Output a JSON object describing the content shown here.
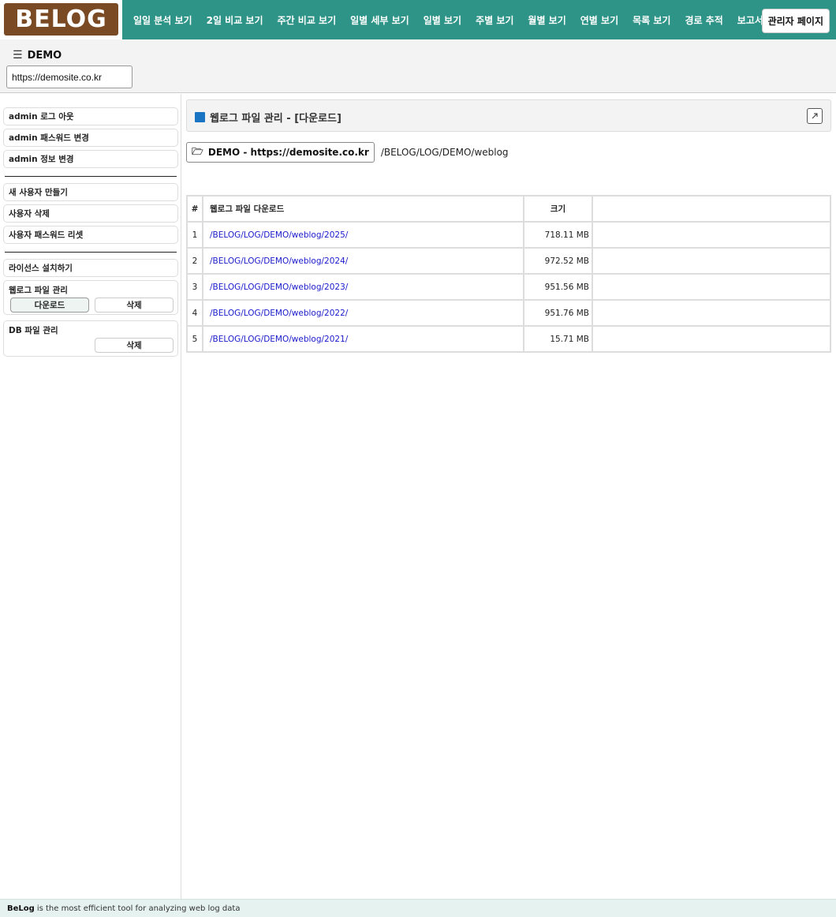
{
  "logo": {
    "text": "BELOG"
  },
  "nav": {
    "items": [
      "일일 분석 보기",
      "2일 비교 보기",
      "주간 비교 보기",
      "일별 세부 보기",
      "일별 보기",
      "주별 보기",
      "월별 보기",
      "연별 보기",
      "목록 보기",
      "경로 추적",
      "보고서"
    ],
    "admin_label": "관리자 페이지"
  },
  "site": {
    "title": "DEMO",
    "selected_url": "https://demosite.co.kr"
  },
  "sidebar": {
    "logout": "admin 로그 아웃",
    "change_password": "admin 패스워드 변경",
    "change_info": "admin 정보 변경",
    "new_user": "새 사용자 만들기",
    "delete_user": "사용자 삭제",
    "reset_password": "사용자 패스워드 리셋",
    "install_license": "라이선스 설치하기",
    "weblog_group": {
      "title": "웹로그 파일 관리",
      "download": "다운로드",
      "delete": "삭제"
    },
    "db_group": {
      "title": "DB 파일 관리",
      "delete": "삭제"
    }
  },
  "panel": {
    "title": "웹로그 파일 관리 - [다운로드]",
    "path_button": "DEMO - https://demosite.co.kr",
    "path": "/BELOG/LOG/DEMO/weblog"
  },
  "table": {
    "headers": {
      "num": "#",
      "name": "웹로그 파일 다운로드",
      "size": "크기"
    },
    "rows": [
      {
        "num": "1",
        "link": "/BELOG/LOG/DEMO/weblog/2025/",
        "size": "718.11 MB"
      },
      {
        "num": "2",
        "link": "/BELOG/LOG/DEMO/weblog/2024/",
        "size": "972.52 MB"
      },
      {
        "num": "3",
        "link": "/BELOG/LOG/DEMO/weblog/2023/",
        "size": "951.56 MB"
      },
      {
        "num": "4",
        "link": "/BELOG/LOG/DEMO/weblog/2022/",
        "size": "951.76 MB"
      },
      {
        "num": "5",
        "link": "/BELOG/LOG/DEMO/weblog/2021/",
        "size": "15.71 MB"
      }
    ]
  },
  "footer": {
    "brand": "BeLog",
    "tagline": "is the most efficient tool for analyzing web log data"
  },
  "colors": {
    "topbar": "#2e9488",
    "logo_bg": "#7a4a24",
    "link": "#1a1acc",
    "title_icon": "#1a74c4"
  },
  "icons": {
    "menu": "hamburger-icon",
    "folder": "folder-open-icon",
    "external": "external-link-icon",
    "title": "square-icon"
  }
}
